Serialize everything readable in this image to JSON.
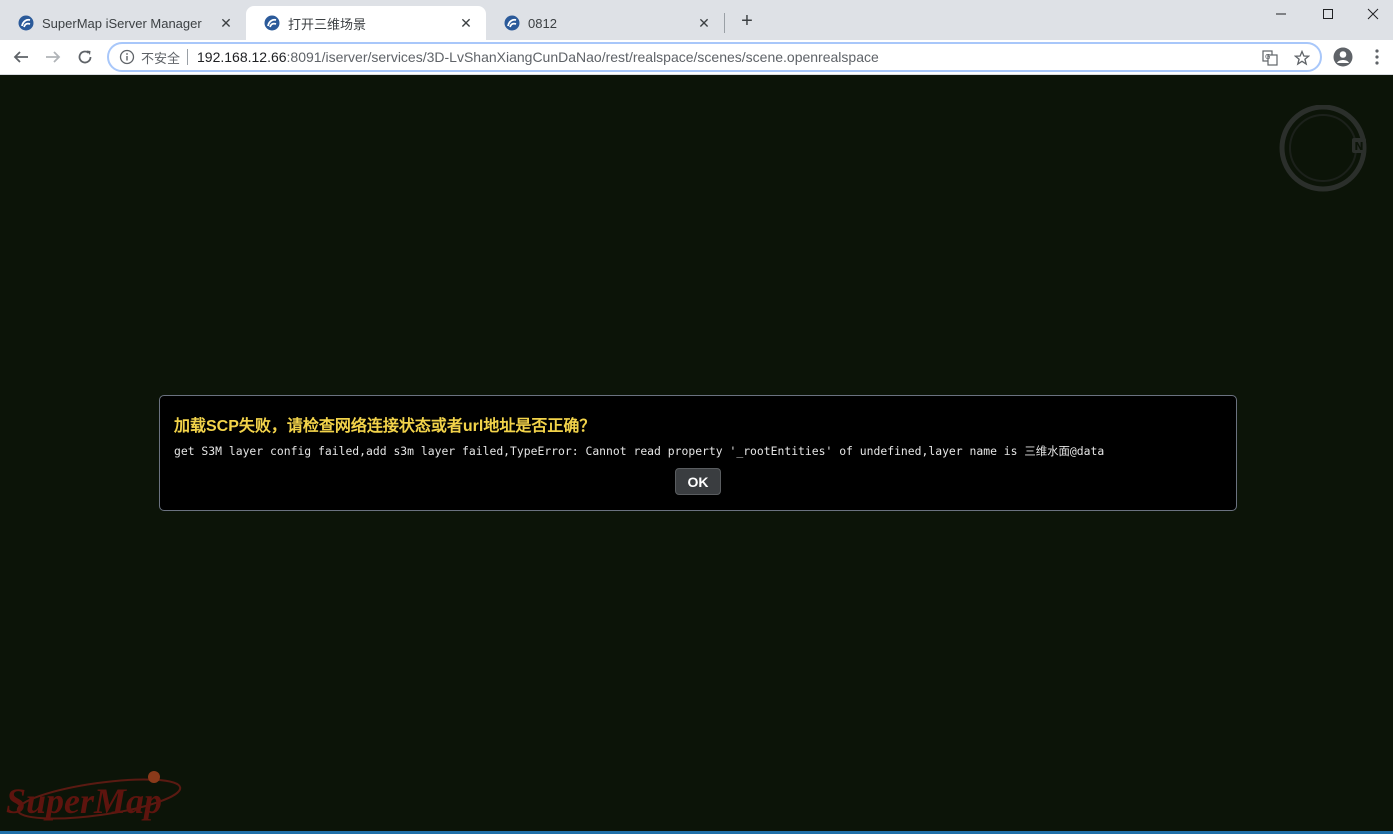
{
  "tabs": [
    {
      "title": "SuperMap iServer Manager",
      "active": false
    },
    {
      "title": "打开三维场景",
      "active": true
    },
    {
      "title": "0812",
      "active": false
    }
  ],
  "new_tab_label": "+",
  "toolbar": {
    "insecure_label": "不安全",
    "url_host": "192.168.12.66",
    "url_rest": ":8091/iserver/services/3D-LvShanXiangCunDaNao/rest/realspace/scenes/scene.openrealspace"
  },
  "dialog": {
    "title": "加载SCP失败，请检查网络连接状态或者url地址是否正确？",
    "message": "get S3M layer config failed,add s3m layer failed,TypeError: Cannot read property '_rootEntities' of undefined,layer name is 三维水面@data",
    "ok_label": "OK"
  },
  "compass_label": "N",
  "logo_text": "SuperMap",
  "icons": [
    "supermap-favicon-icon",
    "close-icon",
    "minimize-icon",
    "maximize-icon",
    "window-close-icon",
    "back-icon",
    "forward-icon",
    "reload-icon",
    "info-icon",
    "translate-icon",
    "star-icon",
    "account-icon",
    "menu-icon",
    "compass-icon"
  ],
  "colors": {
    "viewport_bg": "#0c1408",
    "dialog_title": "#f2d34a",
    "dialog_bg": "#000000"
  }
}
